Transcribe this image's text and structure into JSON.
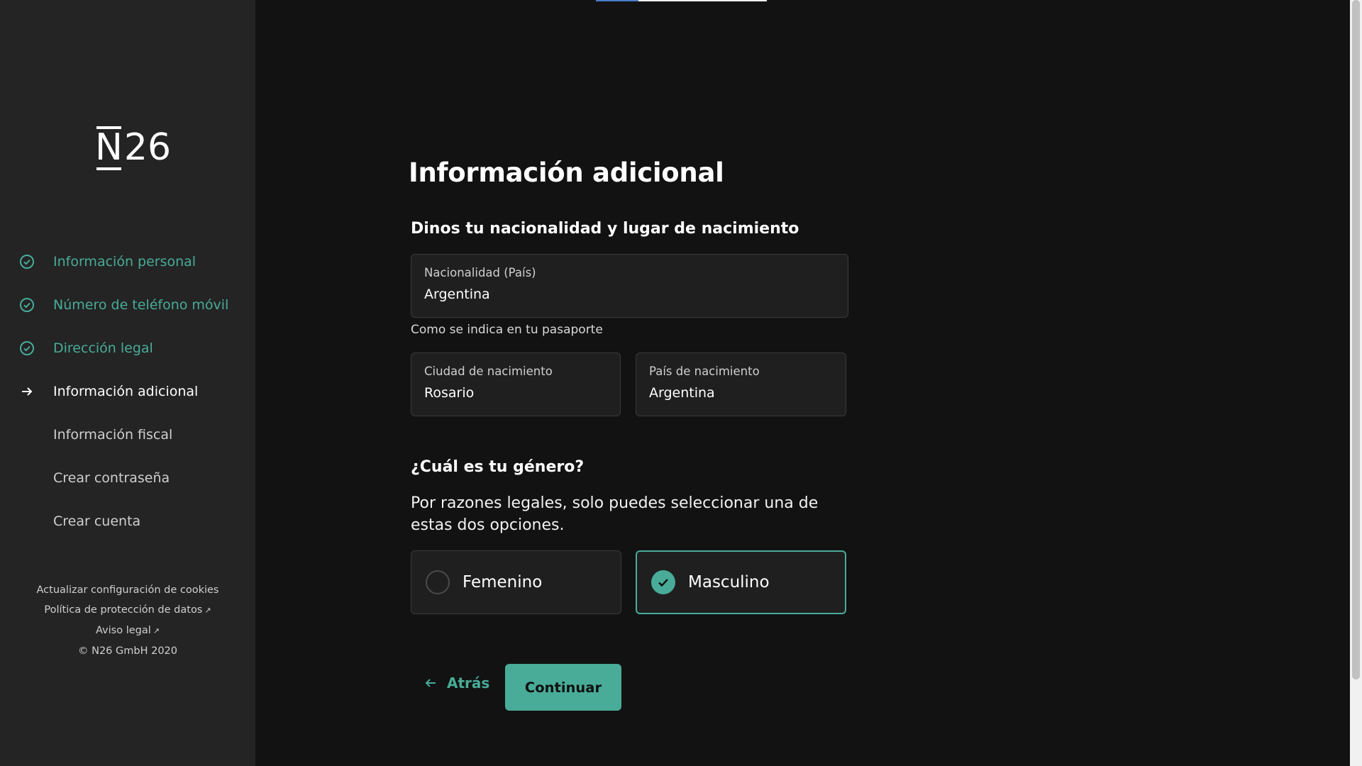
{
  "brand": {
    "logo_text": "N26"
  },
  "progress": {
    "fraction": 0.25
  },
  "sidebar": {
    "steps": [
      {
        "label": "Información personal",
        "status": "done"
      },
      {
        "label": "Número de teléfono móvil",
        "status": "done"
      },
      {
        "label": "Dirección legal",
        "status": "done"
      },
      {
        "label": "Información adicional",
        "status": "current"
      },
      {
        "label": "Información fiscal",
        "status": "todo"
      },
      {
        "label": "Crear contraseña",
        "status": "todo"
      },
      {
        "label": "Crear cuenta",
        "status": "todo"
      }
    ],
    "footer": {
      "cookies": "Actualizar configuración de cookies",
      "privacy": "Política de protección de datos",
      "legal": "Aviso legal",
      "copyright": "© N26 GmbH 2020"
    }
  },
  "main": {
    "title": "Información adicional",
    "nationality_heading": "Dinos tu nacionalidad y lugar de nacimiento",
    "nationality": {
      "label": "Nacionalidad (País)",
      "value": "Argentina"
    },
    "passport_hint": "Como se indica en tu pasaporte",
    "birth_city": {
      "label": "Ciudad de nacimiento",
      "value": "Rosario"
    },
    "birth_country": {
      "label": "País de nacimiento",
      "value": "Argentina"
    },
    "gender_heading": "¿Cuál es tu género?",
    "gender_note": "Por razones legales, solo puedes seleccionar una de estas dos opciones.",
    "gender_options": [
      {
        "label": "Femenino",
        "selected": false
      },
      {
        "label": "Masculino",
        "selected": true
      }
    ],
    "back_label": "Atrás",
    "continue_label": "Continuar"
  },
  "colors": {
    "accent": "#48ac98",
    "sidebar_bg": "#242424",
    "page_bg": "#121212",
    "field_bg": "#1f1f1f"
  },
  "icons": {
    "done": "check-circle-icon",
    "current": "arrow-right-icon",
    "back": "arrow-left-icon",
    "selected": "check-icon",
    "external": "external-link-icon"
  }
}
